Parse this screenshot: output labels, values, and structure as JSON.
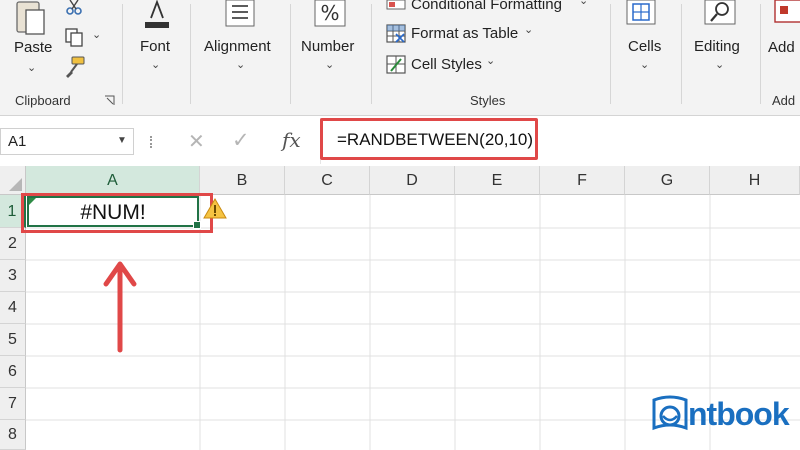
{
  "ribbon": {
    "clipboard": {
      "paste_label": "Paste",
      "group_label": "Clipboard"
    },
    "font_label": "Font",
    "alignment_label": "Alignment",
    "number_label": "Number",
    "styles": {
      "conditional_label": "Conditional Formatting",
      "table_label": "Format as Table",
      "cellstyles_label": "Cell Styles",
      "group_label": "Styles"
    },
    "cells_label": "Cells",
    "editing_label": "Editing",
    "add_label": "Add",
    "add_group_label": "Add"
  },
  "formula_bar": {
    "name_box": "A1",
    "fx_label": "fx",
    "formula": "=RANDBETWEEN(20,10)"
  },
  "grid": {
    "columns": [
      "A",
      "B",
      "C",
      "D",
      "E",
      "F",
      "G",
      "H"
    ],
    "rows": [
      "1",
      "2",
      "3",
      "4",
      "5",
      "6",
      "7",
      "8"
    ],
    "cell_a1": "#NUM!"
  },
  "watermark": {
    "text": "ntbook"
  },
  "colors": {
    "highlight": "#e04848",
    "selection": "#217346",
    "brand": "#1a6fc0"
  }
}
